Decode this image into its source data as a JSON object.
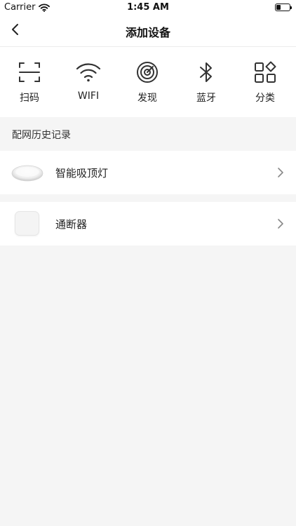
{
  "status_bar": {
    "carrier": "Carrier",
    "time": "1:45 AM",
    "battery_level": 0.35
  },
  "nav": {
    "title": "添加设备",
    "back_icon": "chevron-left-icon"
  },
  "methods": [
    {
      "label": "扫码",
      "icon": "scan-icon"
    },
    {
      "label": "WIFI",
      "icon": "wifi-icon"
    },
    {
      "label": "发现",
      "icon": "radar-icon"
    },
    {
      "label": "蓝牙",
      "icon": "bluetooth-icon"
    },
    {
      "label": "分类",
      "icon": "category-icon"
    }
  ],
  "history": {
    "title": "配网历史记录",
    "devices": [
      {
        "name": "智能吸顶灯",
        "icon": "ceiling-light-image"
      },
      {
        "name": "通断器",
        "icon": "switch-device-image"
      }
    ]
  },
  "colors": {
    "background": "#f5f5f5",
    "card": "#ffffff",
    "text": "#222222",
    "icon": "#333333"
  }
}
